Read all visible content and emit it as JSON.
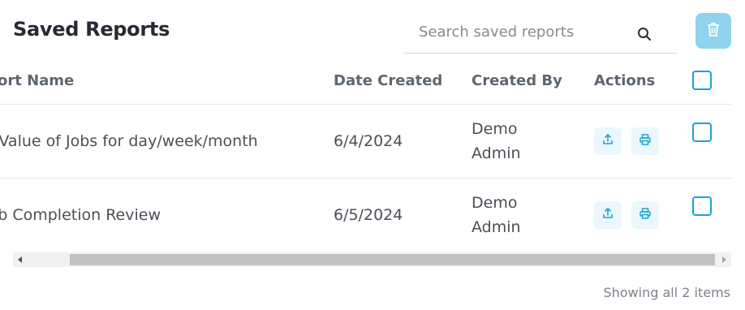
{
  "header": {
    "title": "Saved Reports"
  },
  "search": {
    "placeholder": "Search saved reports"
  },
  "table": {
    "columns": {
      "name": "Report Name",
      "date": "Date Created",
      "by": "Created By",
      "actions": "Actions"
    },
    "rows": [
      {
        "name": "Total Value of Jobs for day/week/month",
        "date": "6/4/2024",
        "created_by": "Demo Admin"
      },
      {
        "name": "Job Completion Review",
        "date": "6/5/2024",
        "created_by": "Demo Admin"
      }
    ]
  },
  "footer": {
    "status": "Showing all 2 items"
  },
  "colors": {
    "accent": "#1aa3d4",
    "trash_bg": "#8fd3ee",
    "action_bg": "#eaf7fc"
  },
  "icons": [
    "search-icon",
    "trash-icon",
    "export-icon",
    "print-icon"
  ]
}
